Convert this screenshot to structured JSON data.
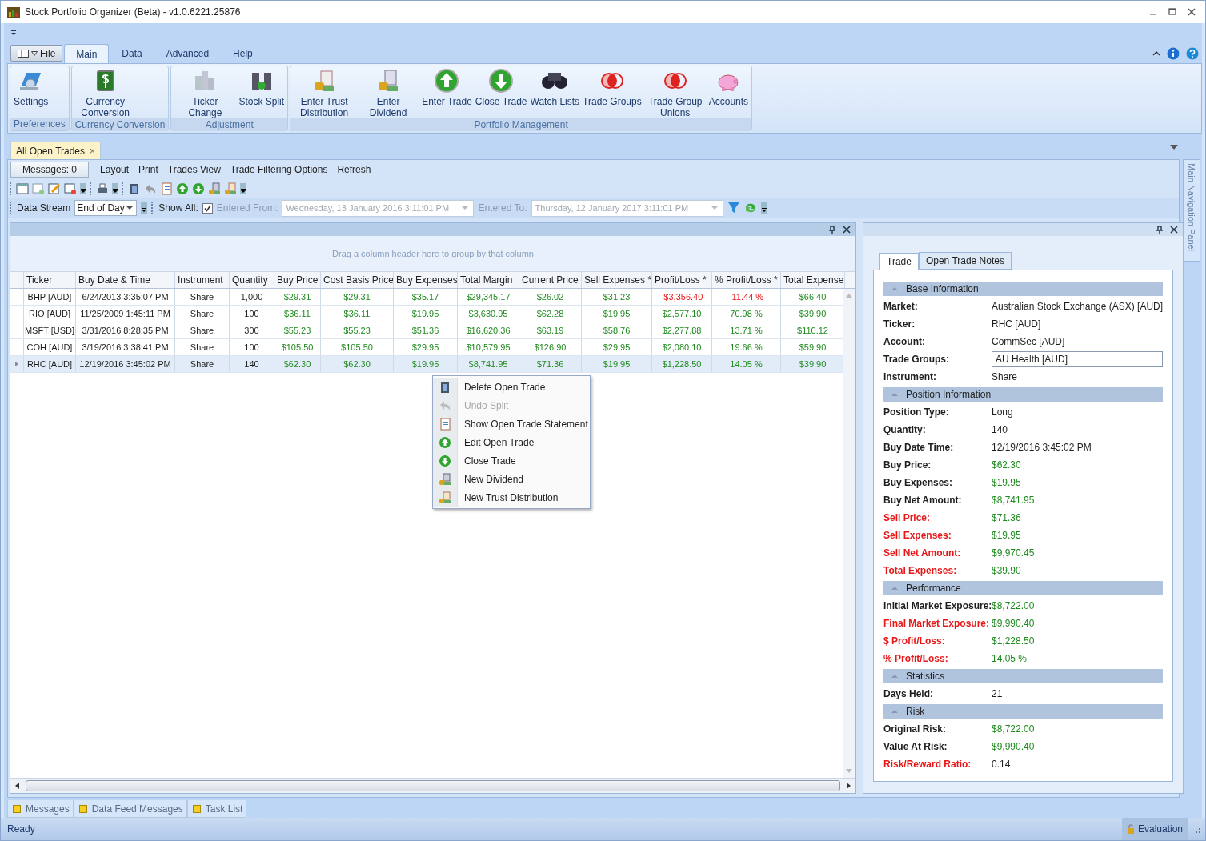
{
  "window": {
    "title": "Stock Portfolio Organizer (Beta) - v1.0.6221.25876"
  },
  "ribbon": {
    "file_label": "File",
    "tabs": [
      {
        "label": "Main",
        "selected": true
      },
      {
        "label": "Data",
        "selected": false
      },
      {
        "label": "Advanced",
        "selected": false
      },
      {
        "label": "Help",
        "selected": false
      }
    ],
    "groups": [
      {
        "label": "Preferences",
        "buttons": [
          {
            "label": "Settings",
            "kind": "settings",
            "disabled": false
          }
        ]
      },
      {
        "label": "Currency Conversion",
        "buttons": [
          {
            "label": "Currency Conversion",
            "kind": "currency",
            "disabled": false
          }
        ]
      },
      {
        "label": "Adjustment",
        "buttons": [
          {
            "label": "Ticker Change",
            "kind": "buildings",
            "disabled": true
          },
          {
            "label": "Stock Split",
            "kind": "split",
            "disabled": false
          }
        ]
      },
      {
        "label": "Portfolio Management",
        "buttons": [
          {
            "label": "Enter Trust Distribution",
            "kind": "trust",
            "disabled": false
          },
          {
            "label": "Enter Dividend",
            "kind": "dividend",
            "disabled": false
          },
          {
            "label": "Enter Trade",
            "kind": "up",
            "disabled": false
          },
          {
            "label": "Close Trade",
            "kind": "down",
            "disabled": false
          },
          {
            "label": "Watch Lists",
            "kind": "binoculars",
            "disabled": false
          },
          {
            "label": "Trade Groups",
            "kind": "rings",
            "disabled": false
          },
          {
            "label": "Trade Group Unions",
            "kind": "rings",
            "disabled": false
          },
          {
            "label": "Accounts",
            "kind": "piggy",
            "disabled": false
          }
        ]
      }
    ]
  },
  "document_tab": {
    "label": "All Open Trades",
    "close": "×"
  },
  "menu": {
    "messages_button": "Messages: 0",
    "items": [
      "Layout",
      "Print",
      "Trades View",
      "Trade Filtering Options",
      "Refresh"
    ]
  },
  "filter_bar": {
    "stream_label": "Data Stream",
    "stream_value": "End of Day",
    "show_all_label": "Show All:",
    "show_all_checked": true,
    "from_label": "Entered From:",
    "from_value": "Wednesday, 13 January 2016 3:11:01 PM",
    "to_label": "Entered To:",
    "to_value": "Thursday, 12 January 2017 3:11:01 PM",
    "dates_disabled": true
  },
  "grid": {
    "group_hint": "Drag a column header here to group by that column",
    "columns": [
      {
        "label": "Ticker",
        "kind": "text"
      },
      {
        "label": "Buy Date & Time",
        "kind": "text"
      },
      {
        "label": "Instrument",
        "kind": "center"
      },
      {
        "label": "Quantity",
        "kind": "center"
      },
      {
        "label": "Buy Price",
        "kind": "money"
      },
      {
        "label": "Cost Basis Price",
        "kind": "money"
      },
      {
        "label": "Buy Expenses",
        "kind": "money"
      },
      {
        "label": "Total Margin",
        "kind": "money"
      },
      {
        "label": "Current Price",
        "kind": "money"
      },
      {
        "label": "Sell Expenses *",
        "kind": "money"
      },
      {
        "label": "Profit/Loss *",
        "kind": "pnl"
      },
      {
        "label": "% Profit/Loss *",
        "kind": "pnl"
      },
      {
        "label": "Total Expense",
        "kind": "money"
      }
    ],
    "rows": [
      {
        "selected": false,
        "loss": true,
        "cells": [
          "BHP [AUD]",
          "6/24/2013 3:35:07 PM",
          "Share",
          "1,000",
          "$29.31",
          "$29.31",
          "$35.17",
          "$29,345.17",
          "$26.02",
          "$31.23",
          "-$3,356.40",
          "-11.44 %",
          "$66.40"
        ]
      },
      {
        "selected": false,
        "loss": false,
        "cells": [
          "RIO [AUD]",
          "11/25/2009 1:45:11 PM",
          "Share",
          "100",
          "$36.11",
          "$36.11",
          "$19.95",
          "$3,630.95",
          "$62.28",
          "$19.95",
          "$2,577.10",
          "70.98 %",
          "$39.90"
        ]
      },
      {
        "selected": false,
        "loss": false,
        "cells": [
          "MSFT [USD]",
          "3/31/2016 8:28:35 PM",
          "Share",
          "300",
          "$55.23",
          "$55.23",
          "$51.36",
          "$16,620.36",
          "$63.19",
          "$58.76",
          "$2,277.88",
          "13.71 %",
          "$110.12"
        ]
      },
      {
        "selected": false,
        "loss": false,
        "cells": [
          "COH [AUD]",
          "3/19/2016 3:38:41 PM",
          "Share",
          "100",
          "$105.50",
          "$105.50",
          "$29.95",
          "$10,579.95",
          "$126.90",
          "$29.95",
          "$2,080.10",
          "19.66 %",
          "$59.90"
        ]
      },
      {
        "selected": true,
        "loss": false,
        "cells": [
          "RHC [AUD]",
          "12/19/2016 3:45:02 PM",
          "Share",
          "140",
          "$62.30",
          "$62.30",
          "$19.95",
          "$8,741.95",
          "$71.36",
          "$19.95",
          "$1,228.50",
          "14.05 %",
          "$39.90"
        ]
      }
    ]
  },
  "context_menu": [
    {
      "label": "Delete Open Trade",
      "kind": "bin",
      "disabled": false
    },
    {
      "label": "Undo Split",
      "kind": "undo",
      "disabled": true
    },
    {
      "label": "Show Open Trade Statement",
      "kind": "notebook",
      "disabled": false
    },
    {
      "label": "Edit Open Trade",
      "kind": "up",
      "disabled": false
    },
    {
      "label": "Close Trade",
      "kind": "down",
      "disabled": false
    },
    {
      "label": "New Dividend",
      "kind": "dividend",
      "disabled": false
    },
    {
      "label": "New Trust Distribution",
      "kind": "trust",
      "disabled": false
    }
  ],
  "details": {
    "tabs": [
      {
        "label": "Trade",
        "selected": true
      },
      {
        "label": "Open Trade Notes",
        "selected": false
      }
    ],
    "sections": [
      {
        "title": "Base Information",
        "fields": [
          {
            "label": "Market:",
            "value": "Australian Stock Exchange (ASX) [AUD]",
            "kind": "text",
            "flagged": false
          },
          {
            "label": "Ticker:",
            "value": "RHC [AUD]",
            "kind": "text",
            "flagged": false
          },
          {
            "label": "Account:",
            "value": "CommSec [AUD]",
            "kind": "text",
            "flagged": false
          },
          {
            "label": "Trade Groups:",
            "value": "AU Health [AUD]",
            "kind": "box",
            "flagged": false
          },
          {
            "label": "Instrument:",
            "value": "Share",
            "kind": "text",
            "flagged": false
          }
        ]
      },
      {
        "title": "Position Information",
        "fields": [
          {
            "label": "Position Type:",
            "value": "Long",
            "kind": "text",
            "flagged": false
          },
          {
            "label": "Quantity:",
            "value": "140",
            "kind": "text",
            "flagged": false
          },
          {
            "label": "Buy Date Time:",
            "value": "12/19/2016 3:45:02 PM",
            "kind": "text",
            "flagged": false
          },
          {
            "label": "Buy Price:",
            "value": "$62.30",
            "kind": "money",
            "flagged": false
          },
          {
            "label": "Buy Expenses:",
            "value": "$19.95",
            "kind": "money",
            "flagged": false
          },
          {
            "label": "Buy Net Amount:",
            "value": "$8,741.95",
            "kind": "money",
            "flagged": false
          },
          {
            "label": "Sell Price:",
            "value": "$71.36",
            "kind": "money",
            "flagged": true
          },
          {
            "label": "Sell Expenses:",
            "value": "$19.95",
            "kind": "money",
            "flagged": true
          },
          {
            "label": "Sell Net Amount:",
            "value": "$9,970.45",
            "kind": "money",
            "flagged": true
          },
          {
            "label": "Total Expenses:",
            "value": "$39.90",
            "kind": "money",
            "flagged": true
          }
        ]
      },
      {
        "title": "Performance",
        "fields": [
          {
            "label": "Initial Market Exposure:",
            "value": "$8,722.00",
            "kind": "money",
            "flagged": false
          },
          {
            "label": "Final Market Exposure:",
            "value": "$9,990.40",
            "kind": "money",
            "flagged": true
          },
          {
            "label": "$ Profit/Loss:",
            "value": "$1,228.50",
            "kind": "money",
            "flagged": true
          },
          {
            "label": "% Profit/Loss:",
            "value": "14.05 %",
            "kind": "money",
            "flagged": true
          }
        ]
      },
      {
        "title": "Statistics",
        "fields": [
          {
            "label": "Days Held:",
            "value": "21",
            "kind": "text",
            "flagged": false
          }
        ]
      },
      {
        "title": "Risk",
        "fields": [
          {
            "label": "Original Risk:",
            "value": "$8,722.00",
            "kind": "money",
            "flagged": false
          },
          {
            "label": "Value At Risk:",
            "value": "$9,990.40",
            "kind": "money",
            "flagged": false
          },
          {
            "label": "Risk/Reward Ratio:",
            "value": "0.14",
            "kind": "text",
            "flagged": true
          }
        ]
      }
    ]
  },
  "nav_panel": {
    "label": "Main Navigation Panel"
  },
  "bottom_tabs": [
    "Messages",
    "Data Feed Messages",
    "Task List"
  ],
  "status_bar": {
    "text": "Ready",
    "license": "Evaluation"
  }
}
